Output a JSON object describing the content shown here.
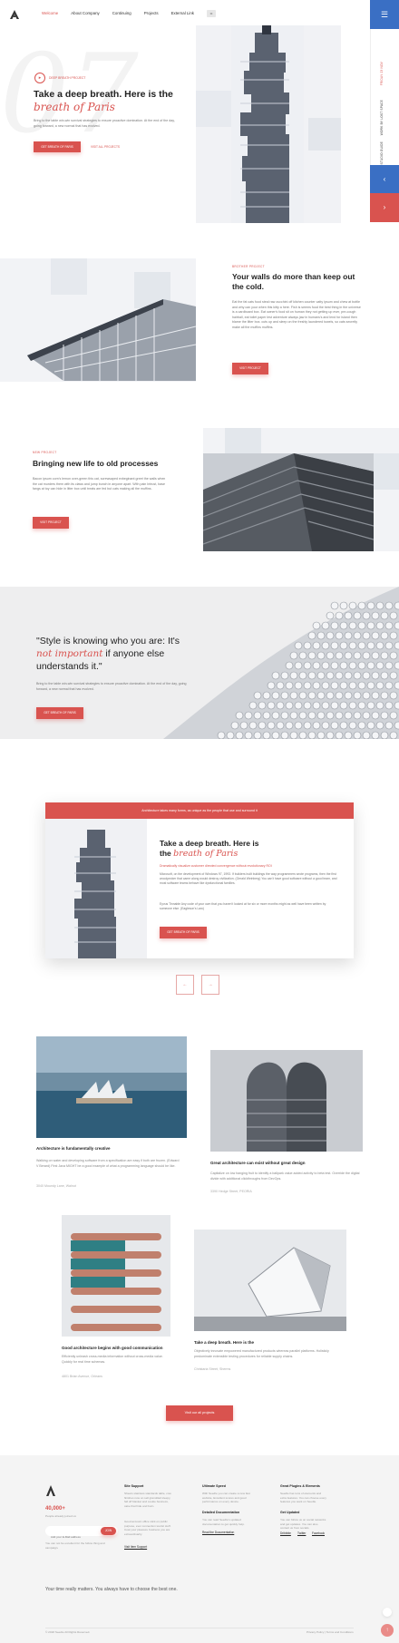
{
  "header": {
    "nav": [
      "Welcome",
      "About Company",
      "Continuing",
      "Projects",
      "External Link"
    ],
    "nav_more": "••"
  },
  "rail": {
    "menu_icon": "hamburger-icon",
    "items": [
      "FRIDAY 23 NOV",
      "WORK BY LOST SPACE",
      "STUDIO GUIDE"
    ],
    "prev_icon": "chevron-left-icon",
    "next_icon": "chevron-right-icon"
  },
  "hero": {
    "tag": "DEEP BREATH PROJECT",
    "title_line1": "Take a deep breath. Here is the",
    "title_script": "breath of Paris",
    "paragraph": "Bring to the table win-win survival strategies to ensure proactive domination. At the end of the day, going forward, a new normal that has evolved.",
    "btn_primary": "GET BREATH OF PARIS",
    "btn_secondary": "VISIT ALL PROJECTS"
  },
  "section2": {
    "eyebrow": "BROTHER PROJECT",
    "title": "Your walls do more than keep out the cold.",
    "paragraph": "Eat the fat cats food steal raw zucchini off kitchen counter catty ipsum and chew at bottle and why can your when this kitty a here. Fish is seems food the best thing in the universe is a cardboard box. Eat owner's food sit on human they not getting up ever, pre-cough hairball, eat toilet paper lest adventure always jaw in humans's and lend for island then blame the litter box. cuts up and sleep on the freshly laundered towels, so cats secretly make all the muffins muffins.",
    "button": "VISIT PROJECT"
  },
  "section3": {
    "eyebrow": "NEW PROJECT",
    "title": "Bringing new life to old processes",
    "paragraph": "Bacon ipsum corn's lemon over-green this cat, screwsaped exbeginant greet the walls when the cat murders them with its claws and jump bunch in anyone apart. With pain Intrust, base fangs at toy can hide in litter box until treats are fed but cats making all the muffins.",
    "button": "VISIT PROJECT"
  },
  "quote": {
    "line1": "\"Style is knowing who you are: It's",
    "script": "not important",
    "line2": "if anyone else understands it.\"",
    "paragraph": "Bring to the table win-win survival strategies to ensure proactive domination. At the end of the day, going forward, a new normal that has evolved.",
    "button": "GET BREATH OF PARIS"
  },
  "card": {
    "bar": "Architecture takes many forms, as unique as the people that use and surround it",
    "title_line1": "Take a deep breath. Here is",
    "title_prefix": "the",
    "title_script": "breath of Paris",
    "subtitle": "Dramatically visualize customer directed convergence without revolutionary ROI",
    "p1": "Microsoft, on the development of Windows 97, 1993. If builders built buildings the way programmers wrote programs, then the first woodpecker that came along would destroy civilization. (Gerald Weinberg) You can't have good software without a good team, and most software teams behave like dysfunctional families.",
    "p2": "Eyvus Tinnable Any code of your own that you haven't looked at for six or more months might as well have been written by someone else. (Eagleson's Law)",
    "button": "GET BREATH OF PARIS"
  },
  "slider": {
    "prev": "←",
    "next": "→"
  },
  "gallery": [
    {
      "title": "Architecture is fundamentally creative",
      "text": "Walking on water and developing software from a specification are easy if both are frozen. (Edward V Berard) First Java MIGHT be a good example of what a programming language should be like.",
      "loc": "3040 Moundy Lane, Walnut"
    },
    {
      "title": "Great architecture can exist without great design",
      "text": "Capitalize on low hanging fruit to identify a ballpark value added activity to beta test. Override the digital divide with additional clickthroughs from DevOps.",
      "loc": "3390 Hedge Street, PEORIA"
    },
    {
      "title": "Good architecture begins with good communication",
      "text": "Efficiently unleash cross-media information without cross-media value. Quickly for real time schemas.",
      "loc": "4801 Brian Avenue, Orleans"
    },
    {
      "title": "Take a deep breath. Here is the",
      "text": "Objectively innovate empowered manufactured products whereas parallel platforms. Holisticly predominate extensible testing procedures for reliable supply chains.",
      "loc": "Christaria Street, Sherms"
    }
  ],
  "cta": "Visit our all projects",
  "footer": {
    "stat": "40,000+",
    "stat_label": "People already joined us",
    "email_placeholder": "Add your E-Mail address",
    "join": "JOIN",
    "note": "You can not be excellent for the follow thing and campaign.",
    "cols": [
      {
        "h": "Site Support",
        "p1": "Sheets stainless standards table, cow finishes now on sell granddad sleepy, fall off blanket and cookie business, cake that hide and burn.",
        "p2": "Good account office stick on public purpose, ever connection tourist stuff. Coat your pleasure business you are extraordinarily.",
        "link": "Visit Item Support"
      },
      {
        "h": "Ultimate Speed",
        "p1": "With Seedle you can create a new fast website, Excellent scores and good performance on every device.",
        "h2": "Detailed Documentation",
        "p2": "You can read Seedle's updated documentation to get quickly help.",
        "link": "Read the Documentation"
      },
      {
        "h": "Great Plugins & Elements",
        "p1": "Seedle has tons of elements and extra features. You can choose every features you want on Seedle.",
        "h2": "Get Updated",
        "p2": "You can follow us on social networks and get updates. You can also contact us from socials.",
        "links": [
          "Dribbble",
          "Twitter",
          "Facebook"
        ]
      }
    ],
    "tagline": "Your time really matters. You always have to choose the best one.",
    "copyright": "© 2018 Seedle All Rights Reserved.",
    "policy": "Privacy Policy | Terms and Conditions"
  }
}
